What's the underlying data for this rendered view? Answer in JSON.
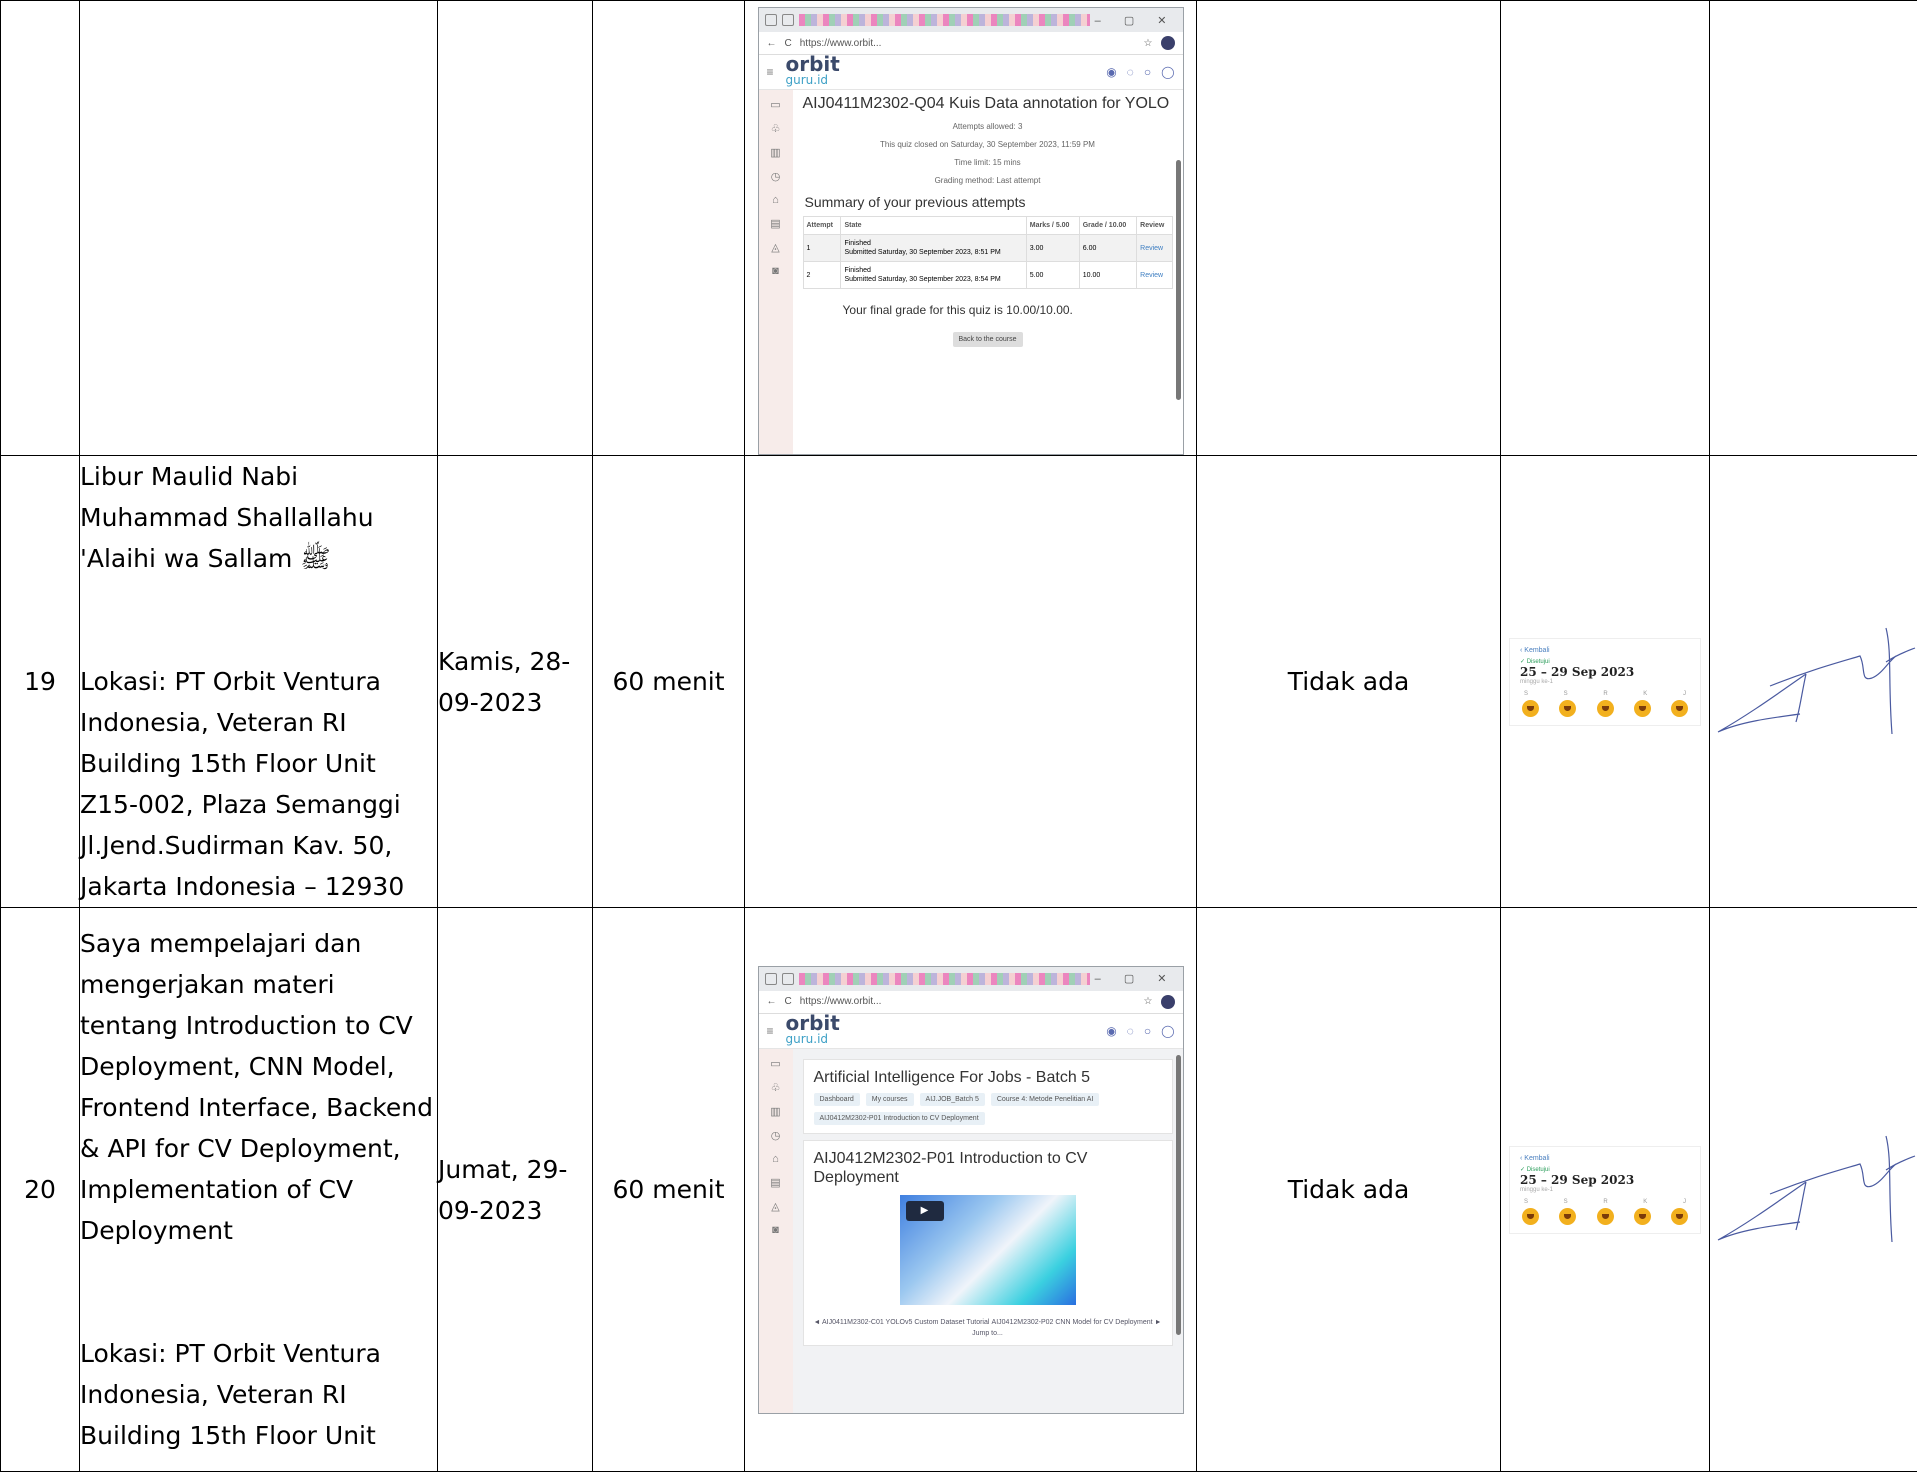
{
  "rows": [
    {
      "no": "",
      "activity": "",
      "date": "",
      "duration": "",
      "output": "",
      "screenshot": {
        "window_controls": "– ▢ ✕",
        "url": "https://www.orbit...",
        "logo_top": "orbit",
        "logo_bottom": "guru.id",
        "title": "AIJ0411M2302-Q04 Kuis Data annotation for YOLO",
        "attempts_allowed": "Attempts allowed: 3",
        "closed_on": "This quiz closed on Saturday, 30 September 2023, 11:59 PM",
        "time_limit": "Time limit: 15 mins",
        "grading_method": "Grading method: Last attempt",
        "summary_title": "Summary of your previous attempts",
        "headers": [
          "Attempt",
          "State",
          "Marks / 5.00",
          "Grade / 10.00",
          "Review"
        ],
        "attempts": [
          {
            "attempt": "1",
            "state": "Finished\nSubmitted Saturday, 30 September 2023, 8:51 PM",
            "marks": "3.00",
            "grade": "6.00",
            "review": "Review"
          },
          {
            "attempt": "2",
            "state": "Finished\nSubmitted Saturday, 30 September 2023, 8:54 PM",
            "marks": "5.00",
            "grade": "10.00",
            "review": "Review"
          }
        ],
        "final_grade": "Your final grade for this quiz is 10.00/10.00.",
        "back_button": "Back to the course"
      }
    },
    {
      "no": "19",
      "activity": "Libur Maulid Nabi Muhammad Shallallahu 'Alaihi wa Sallam ﷺ",
      "location": "Lokasi: PT Orbit Ventura Indonesia, Veteran RI Building 15th Floor Unit Z15-002, Plaza Semanggi Jl.Jend.Sudirman Kav. 50, Jakarta Indonesia – 12930",
      "date": "Kamis, 28-09-2023",
      "duration": "60 menit",
      "output": "Tidak ada",
      "calendar": {
        "back_label": "‹ Kembali",
        "status": "✓ Disetujui",
        "range": "25 – 29 Sep 2023",
        "week": "minggu ke-1",
        "days": [
          "S",
          "S",
          "R",
          "K",
          "J"
        ]
      }
    },
    {
      "no": "20",
      "activity": "Saya mempelajari dan mengerjakan materi tentang Introduction to CV Deployment, CNN Model, Frontend Interface, Backend & API for CV Deployment, Implementation of CV Deployment",
      "location": "Lokasi: PT Orbit Ventura Indonesia, Veteran RI Building 15th Floor Unit",
      "date": "Jumat, 29-09-2023",
      "duration": "60 menit",
      "output": "Tidak ada",
      "screenshot": {
        "url": "https://www.orbit...",
        "course_title": "Artificial Intelligence For Jobs - Batch 5",
        "breadcrumbs": [
          "Dashboard",
          "My courses",
          "AIJ.JOB_Batch 5",
          "Course 4: Metode Penelitian AI",
          "AIJ0412M2302-P01 Introduction to CV Deployment"
        ],
        "lesson_title": "AIJ0412M2302-P01 Introduction to CV Deployment",
        "play": "▶",
        "jump_to": "Jump to...",
        "next_link": "AIJ0412M2302-P02 CNN Model for CV Deployment ►",
        "prev_link": "◄ AIJ0411M2302-C01 YOLOv5 Custom Dataset Tutorial"
      },
      "calendar": {
        "back_label": "‹ Kembali",
        "status": "✓ Disetujui",
        "range": "25 – 29 Sep 2023",
        "week": "minggu ke-1",
        "days": [
          "S",
          "S",
          "R",
          "K",
          "J"
        ]
      }
    }
  ],
  "colors": {
    "border": "#000000",
    "accent": "#3da0c6",
    "approved": "#2a9d5a",
    "emoji": "#f2b01e"
  }
}
